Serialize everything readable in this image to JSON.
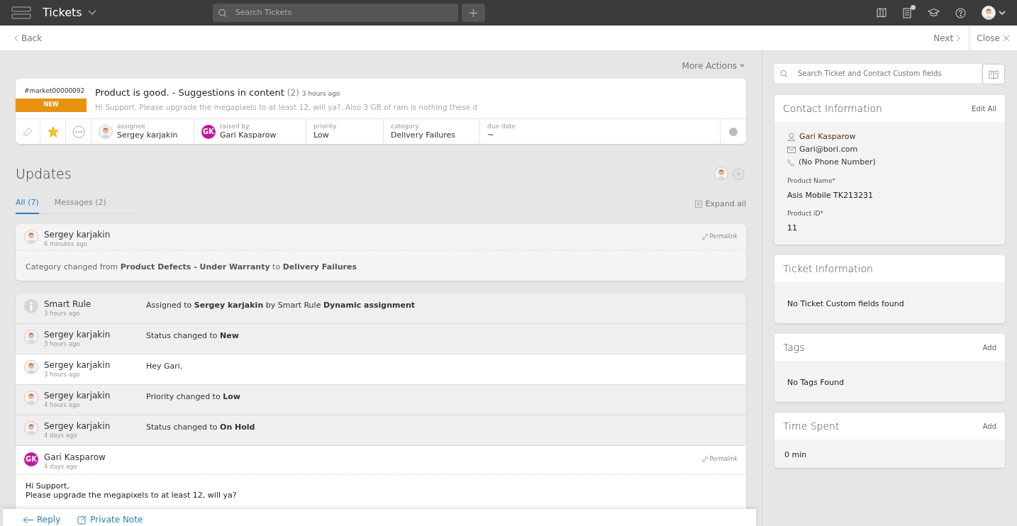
{
  "topbar": {
    "title": "Tickets",
    "search_placeholder": "Search Tickets",
    "has_notification": true
  },
  "nav": {
    "back": "Back",
    "next": "Next",
    "close": "Close"
  },
  "more_actions": "More Actions",
  "ticket": {
    "id": "#market00000092",
    "status": "NEW",
    "title": "Product is good. - Suggestions in content",
    "count": "(2)",
    "time": "3 hours ago",
    "preview": "Hi Support, Please upgrade the megapixels to at least 12, will ya?. Also 3 GB of ram is nothing these d",
    "starred": true,
    "fields": [
      {
        "label": "assignee",
        "value": "Sergey karjakin",
        "avatar": {
          "kind": "person"
        }
      },
      {
        "label": "raised by",
        "value": "Gari Kasparow",
        "avatar": {
          "kind": "initials",
          "initials": "GK"
        }
      },
      {
        "label": "priority",
        "value": "Low"
      },
      {
        "label": "category",
        "value": "Delivery Failures"
      },
      {
        "label": "due date",
        "value": "~"
      }
    ]
  },
  "updates": {
    "title": "Updates",
    "expand": "Expand all",
    "tabs": [
      {
        "label": "All (7)",
        "selected": true
      },
      {
        "label": "Messages (2)",
        "selected": false
      }
    ],
    "first": {
      "author": "Sergey karjakin",
      "time": "6 minutes ago",
      "avatar": {
        "kind": "person"
      },
      "permalink": "Permalink",
      "text": "Category changed from **Product Defects - Under Warranty** to **Delivery Failures**"
    },
    "rows": [
      {
        "author": "Smart Rule",
        "time": "3 hours ago",
        "avatar": {
          "kind": "info"
        },
        "text": "Assigned to **Sergey karjakin** by Smart Rule **Dynamic assignment**",
        "kind": "event"
      },
      {
        "author": "Sergey karjakin",
        "time": "3 hours ago",
        "avatar": {
          "kind": "person"
        },
        "text": "Status changed to **New**",
        "kind": "event"
      },
      {
        "author": "Sergey karjakin",
        "time": "3 hours ago",
        "avatar": {
          "kind": "person"
        },
        "text": "Hey Gari,",
        "kind": "message"
      },
      {
        "author": "Sergey karjakin",
        "time": "4 hours ago",
        "avatar": {
          "kind": "person"
        },
        "text": "Priority changed to **Low**",
        "kind": "event"
      },
      {
        "author": "Sergey karjakin",
        "time": "4 days ago",
        "avatar": {
          "kind": "person"
        },
        "text": "Status changed to **On Hold**",
        "kind": "event"
      }
    ],
    "message": {
      "author": "Gari Kasparow",
      "time": "4 days ago",
      "avatar": {
        "kind": "initials",
        "initials": "GK"
      },
      "permalink": "Permalink",
      "body": [
        "Hi Support,",
        "Please upgrade the megapixels to at least 12, will ya?"
      ]
    }
  },
  "reply_bar": {
    "reply": "Reply",
    "private_note": "Private Note"
  },
  "side": {
    "search_placeholder": "Search Ticket and Contact Custom fields",
    "contact": {
      "title": "Contact Information",
      "action": "Edit All",
      "name": "Gari Kasparow",
      "email": "Gari@bori.com",
      "phone": "(No Phone Number)",
      "fields": [
        {
          "label": "Product Name*",
          "value": "Asis Mobile TK213231"
        },
        {
          "label": "Product iD*",
          "value": "11"
        }
      ]
    },
    "ticket_info": {
      "title": "Ticket Information",
      "empty": "No Ticket Custom fields found"
    },
    "tags": {
      "title": "Tags",
      "action": "Add",
      "empty": "No Tags Found"
    },
    "time_spent": {
      "title": "Time Spent",
      "action": "Add",
      "value": "0 min"
    }
  }
}
